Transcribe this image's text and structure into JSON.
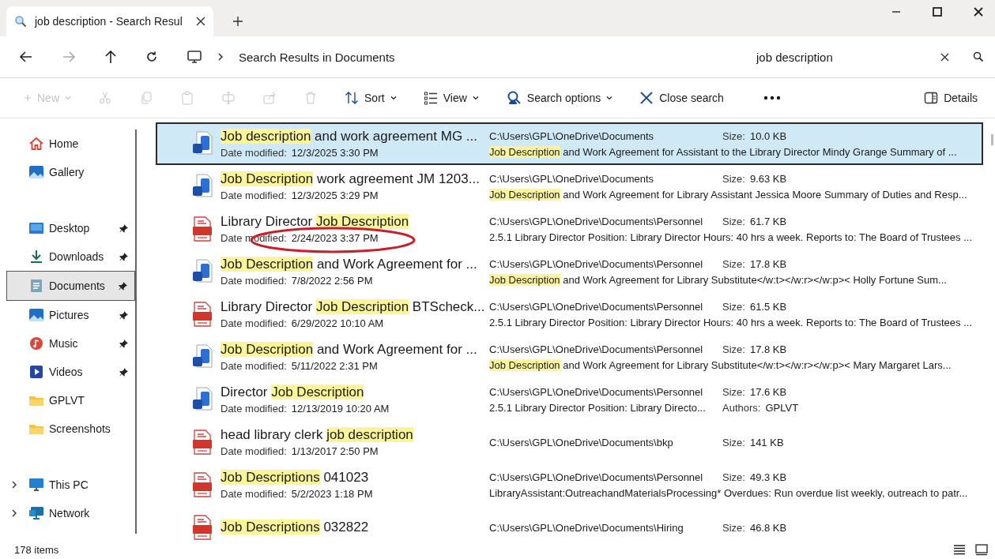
{
  "window": {
    "tab": {
      "title": "job description - Search Resul"
    }
  },
  "address_bar": {
    "forward_disabled": true,
    "location": "Search Results in Documents"
  },
  "search": {
    "value": "job description"
  },
  "toolbar": [
    {
      "kind": "new",
      "label": "New",
      "disabled": true
    },
    {
      "kind": "cut",
      "disabled": true
    },
    {
      "kind": "copy",
      "disabled": true
    },
    {
      "kind": "paste",
      "disabled": true
    },
    {
      "kind": "rename",
      "disabled": true
    },
    {
      "kind": "share",
      "disabled": true
    },
    {
      "kind": "delete",
      "disabled": true
    },
    {
      "kind": "sort",
      "label": "Sort",
      "disabled": false
    },
    {
      "kind": "view",
      "label": "View",
      "disabled": false
    },
    {
      "kind": "search_options",
      "label": "Search options",
      "disabled": false
    },
    {
      "kind": "close_search",
      "label": "Close search",
      "disabled": false
    },
    {
      "kind": "more",
      "disabled": false
    },
    {
      "kind": "details",
      "label": "Details",
      "disabled": false
    }
  ],
  "sidebar": {
    "groups": [
      {
        "items": [
          {
            "kind": "home",
            "label": "Home",
            "pinned": false,
            "expandable": false,
            "selected": false
          },
          {
            "kind": "gallery",
            "label": "Gallery",
            "pinned": false,
            "expandable": false,
            "selected": false
          }
        ]
      },
      {
        "items": [
          {
            "kind": "desktop",
            "label": "Desktop",
            "pinned": true,
            "expandable": false,
            "selected": false
          },
          {
            "kind": "downloads",
            "label": "Downloads",
            "pinned": true,
            "expandable": false,
            "selected": false
          },
          {
            "kind": "documents",
            "label": "Documents",
            "pinned": true,
            "expandable": false,
            "selected": true
          },
          {
            "kind": "pictures",
            "label": "Pictures",
            "pinned": true,
            "expandable": false,
            "selected": false
          },
          {
            "kind": "music",
            "label": "Music",
            "pinned": true,
            "expandable": false,
            "selected": false
          },
          {
            "kind": "videos",
            "label": "Videos",
            "pinned": true,
            "expandable": false,
            "selected": false
          },
          {
            "kind": "folder",
            "label": "GPLVT",
            "pinned": false,
            "expandable": false,
            "selected": false
          },
          {
            "kind": "folder",
            "label": "Screenshots",
            "pinned": false,
            "expandable": false,
            "selected": false
          }
        ]
      },
      {
        "items": [
          {
            "kind": "pc",
            "label": "This PC",
            "pinned": false,
            "expandable": true,
            "selected": false
          },
          {
            "kind": "network",
            "label": "Network",
            "pinned": false,
            "expandable": true,
            "selected": false
          }
        ]
      }
    ]
  },
  "results": [
    {
      "kind": "word",
      "selected": true,
      "circled": false,
      "name": [
        {
          "text": "Job description",
          "highlight": true
        },
        {
          "text": " and work agreement MG ...",
          "highlight": false
        }
      ],
      "date_label": "Date modified:",
      "date": "12/3/2025 3:30 PM",
      "path": "C:\\Users\\GPL\\OneDrive\\Documents",
      "size_label": "Size:",
      "size": "10.0 KB",
      "snippet": [
        {
          "text": "Job Description",
          "highlight": true
        },
        {
          "text": " and Work Agreement for Assistant to the Library Director Mindy Grange Summary of ...",
          "highlight": false
        }
      ]
    },
    {
      "kind": "word",
      "selected": false,
      "circled": false,
      "name": [
        {
          "text": "Job Description",
          "highlight": true
        },
        {
          "text": " work agreement JM 1203...",
          "highlight": false
        }
      ],
      "date_label": "Date modified:",
      "date": "12/3/2025 3:29 PM",
      "path": "C:\\Users\\GPL\\OneDrive\\Documents",
      "size_label": "Size:",
      "size": "9.63 KB",
      "snippet": [
        {
          "text": "Job Description",
          "highlight": true
        },
        {
          "text": " and Work Agreement for Library Assistant Jessica Moore Summary of Duties and Resp...",
          "highlight": false
        }
      ]
    },
    {
      "kind": "pdf",
      "selected": false,
      "circled": true,
      "name": [
        {
          "text": "Library Director ",
          "highlight": false
        },
        {
          "text": "Job Description",
          "highlight": true
        }
      ],
      "date_label": "Date modified:",
      "date": "2/24/2023 3:37 PM",
      "path": "C:\\Users\\GPL\\OneDrive\\Documents\\Personnel",
      "size_label": "Size:",
      "size": "61.7 KB",
      "snippet": [
        {
          "text": "2.5.1 Library Director Position: Library Director Hours: 40 hrs a week. Reports to: The Board of Trustees ...",
          "highlight": false
        }
      ]
    },
    {
      "kind": "word",
      "selected": false,
      "circled": false,
      "name": [
        {
          "text": "Job Description",
          "highlight": true
        },
        {
          "text": " and Work Agreement for ...",
          "highlight": false
        }
      ],
      "date_label": "Date modified:",
      "date": "7/8/2022 2:56 PM",
      "path": "C:\\Users\\GPL\\OneDrive\\Documents\\Personnel",
      "size_label": "Size:",
      "size": "17.8 KB",
      "snippet": [
        {
          "text": "Job Description",
          "highlight": true
        },
        {
          "text": " and Work Agreement for Library Substitute</w:t></w:r></w:p>< Holly Fortune Sum...",
          "highlight": false
        }
      ]
    },
    {
      "kind": "pdf",
      "selected": false,
      "circled": false,
      "name": [
        {
          "text": "Library Director ",
          "highlight": false
        },
        {
          "text": "Job Description",
          "highlight": true
        },
        {
          "text": " BTScheck...",
          "highlight": false
        }
      ],
      "date_label": "Date modified:",
      "date": "6/29/2022 10:10 AM",
      "path": "C:\\Users\\GPL\\OneDrive\\Documents\\Personnel",
      "size_label": "Size:",
      "size": "61.5 KB",
      "snippet": [
        {
          "text": "2.5.1 Library Director Position: Library Director Hours: 40 hrs a week. Reports to: The Board of Trustees ...",
          "highlight": false
        }
      ]
    },
    {
      "kind": "word",
      "selected": false,
      "circled": false,
      "name": [
        {
          "text": "Job Description",
          "highlight": true
        },
        {
          "text": " and Work Agreement for ...",
          "highlight": false
        }
      ],
      "date_label": "Date modified:",
      "date": "5/11/2022 2:31 PM",
      "path": "C:\\Users\\GPL\\OneDrive\\Documents\\Personnel",
      "size_label": "Size:",
      "size": "17.8 KB",
      "snippet": [
        {
          "text": "Job Description",
          "highlight": true
        },
        {
          "text": " and Work Agreement for Library Substitute</w:t></w:r></w:p>< Mary Margaret Lars...",
          "highlight": false
        }
      ]
    },
    {
      "kind": "word",
      "selected": false,
      "circled": false,
      "name": [
        {
          "text": "Director ",
          "highlight": false
        },
        {
          "text": "Job Description",
          "highlight": true
        }
      ],
      "date_label": "Date modified:",
      "date": "12/13/2019 10:20 AM",
      "path": "C:\\Users\\GPL\\OneDrive\\Documents\\Personnel",
      "size_label": "Size:",
      "size": "17.6 KB",
      "snippet": [
        {
          "text": "2.5.1 Library Director Position: Library Directo...",
          "highlight": false
        }
      ],
      "authors_label": "Authors:",
      "authors": "GPLVT"
    },
    {
      "kind": "pdf",
      "selected": false,
      "circled": false,
      "name": [
        {
          "text": "head library clerk ",
          "highlight": false
        },
        {
          "text": "job description",
          "highlight": true
        }
      ],
      "date_label": "Date modified:",
      "date": "1/13/2017 2:50 PM",
      "path": "C:\\Users\\GPL\\OneDrive\\Documents\\bkp",
      "size_label": "Size:",
      "size": "141 KB"
    },
    {
      "kind": "pdf",
      "selected": false,
      "circled": false,
      "name": [
        {
          "text": "Job Descriptions",
          "highlight": true
        },
        {
          "text": " 041023",
          "highlight": false
        }
      ],
      "date_label": "Date modified:",
      "date": "5/2/2023 1:18 PM",
      "path": "C:\\Users\\GPL\\OneDrive\\Documents\\Personnel",
      "size_label": "Size:",
      "size": "49.3 KB",
      "snippet": [
        {
          "text": "LibraryAssistant:OutreachandMaterialsProcessing* Overdues: Run overdue list weekly, outreach to patr...",
          "highlight": false
        }
      ]
    },
    {
      "kind": "pdf",
      "selected": false,
      "circled": false,
      "name": [
        {
          "text": "Job Descriptions",
          "highlight": true
        },
        {
          "text": " 032822",
          "highlight": false
        }
      ],
      "path": "C:\\Users\\GPL\\OneDrive\\Documents\\Hiring",
      "size_label": "Size:",
      "size": "46.8 KB"
    }
  ],
  "status_bar": {
    "count": "178 items"
  }
}
